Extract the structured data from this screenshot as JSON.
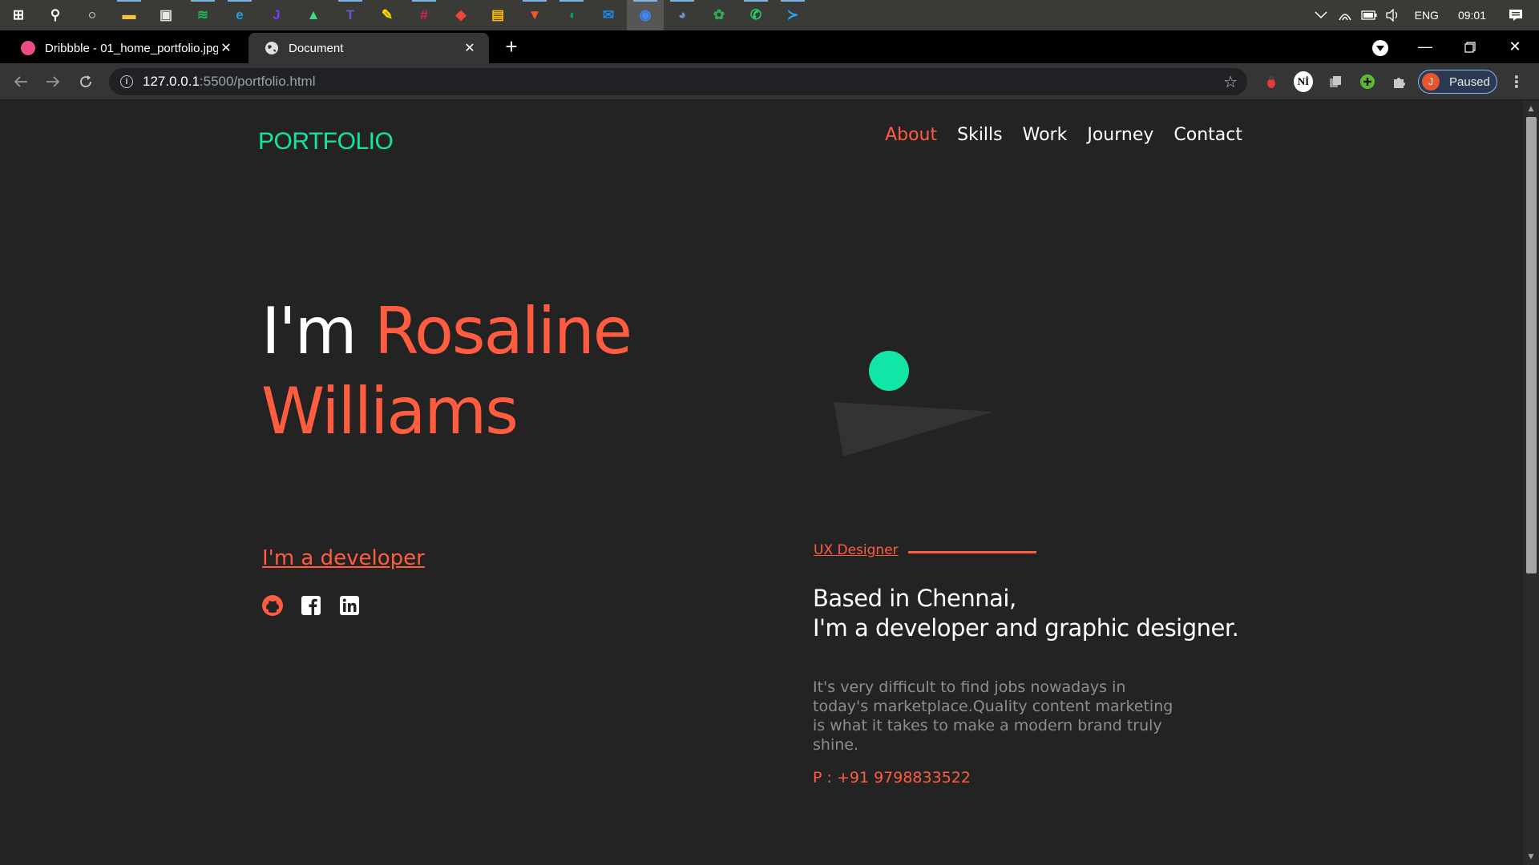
{
  "taskbar": {
    "apps": [
      {
        "name": "windows-start-icon",
        "glyph": "⊞",
        "color": "#ffffff"
      },
      {
        "name": "search-icon",
        "glyph": "⚲",
        "color": "#ffffff"
      },
      {
        "name": "cortana-icon",
        "glyph": "○",
        "color": "#ffffff"
      },
      {
        "name": "file-explorer-icon",
        "glyph": "▬",
        "color": "#f4c542"
      },
      {
        "name": "store-icon",
        "glyph": "▣",
        "color": "#e6e6e6"
      },
      {
        "name": "spotify-icon",
        "glyph": "≋",
        "color": "#1db954"
      },
      {
        "name": "edge-icon",
        "glyph": "e",
        "color": "#1fa0e0"
      },
      {
        "name": "jetbrains-icon",
        "glyph": "J",
        "color": "#7c3aed"
      },
      {
        "name": "android-studio-icon",
        "glyph": "▲",
        "color": "#3ddc84"
      },
      {
        "name": "teams-icon",
        "glyph": "T",
        "color": "#5b5fc7"
      },
      {
        "name": "sticky-notes-icon",
        "glyph": "✎",
        "color": "#ffd700"
      },
      {
        "name": "slack-icon",
        "glyph": "#",
        "color": "#e01e5a"
      },
      {
        "name": "anydesk-icon",
        "glyph": "◆",
        "color": "#ef443b"
      },
      {
        "name": "google-slides-icon",
        "glyph": "▤",
        "color": "#fbbc04"
      },
      {
        "name": "brave-icon",
        "glyph": "▼",
        "color": "#fb542b"
      },
      {
        "name": "mongodb-icon",
        "glyph": "◖",
        "color": "#00a35c"
      },
      {
        "name": "mail-icon",
        "glyph": "✉",
        "color": "#1e88e5"
      },
      {
        "name": "chrome-icon",
        "glyph": "◉",
        "color": "#4285f4"
      },
      {
        "name": "discord-icon",
        "glyph": "◕",
        "color": "#7289da"
      },
      {
        "name": "paint-icon",
        "glyph": "✿",
        "color": "#34a853"
      },
      {
        "name": "whatsapp-icon",
        "glyph": "✆",
        "color": "#25d366"
      },
      {
        "name": "vscode-icon",
        "glyph": "≻",
        "color": "#23a9f2"
      }
    ],
    "lang": "ENG",
    "time": "09:01"
  },
  "tabs": [
    {
      "title": "Dribbble - 01_home_portfolio.jpg",
      "favicon_color": "#ea4c89"
    },
    {
      "title": "Document",
      "favicon_color": "#e0e0e0"
    }
  ],
  "omnibox": {
    "host": "127.0.0.1",
    "path": ":5500/portfolio.html"
  },
  "profile": {
    "initial": "J",
    "status": "Paused"
  },
  "page": {
    "logo": "PORTFOLIO",
    "nav": [
      {
        "label": "About",
        "active": true
      },
      {
        "label": "Skills",
        "active": false
      },
      {
        "label": "Work",
        "active": false
      },
      {
        "label": "Journey",
        "active": false
      },
      {
        "label": "Contact",
        "active": false
      }
    ],
    "hero": {
      "prefix": "I'm ",
      "first_name": "Rosaline",
      "last_name": "Williams"
    },
    "developer_link": "I'm a developer",
    "socials": [
      "github-icon",
      "facebook-icon",
      "linkedin-icon"
    ],
    "role": "UX Designer",
    "intro_line1": "Based in Chennai,",
    "intro_line2": "I'm a developer and graphic designer.",
    "description": "It's very difficult to find jobs nowadays in today's marketplace.Quality content marketing is what it takes to make a modern brand truly shine.",
    "phone": "P : +91 9798833522"
  },
  "colors": {
    "accent": "#ff5c40",
    "logo": "#11e6a7",
    "background": "#232323"
  }
}
